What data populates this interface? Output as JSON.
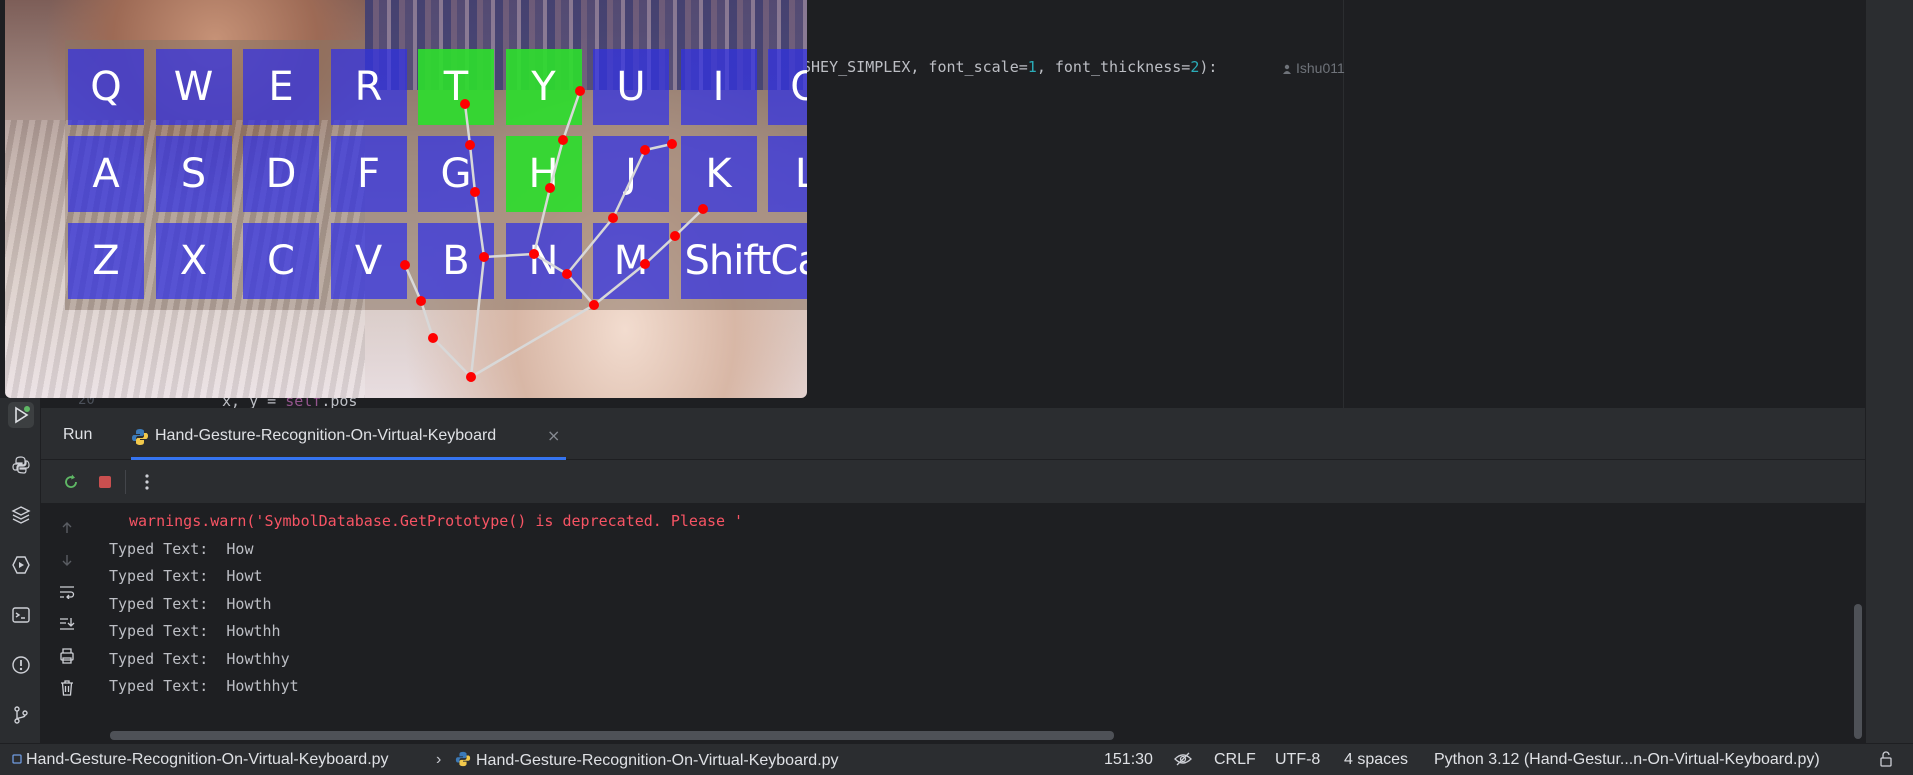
{
  "editor": {
    "code_fragment": {
      "prefix": "SHEY_SIMPLEX, font_scale=",
      "scale_value": "1",
      "middle": ", font_thickness=",
      "thickness_value": "2",
      "suffix": "):"
    },
    "author": "Ishu011",
    "partial_line_number": "20",
    "partial_line_code": "x, y = ",
    "partial_line_self": "self",
    "partial_line_tail": ".pos"
  },
  "keyboard": {
    "rows": [
      [
        "Q",
        "W",
        "E",
        "R",
        "T",
        "Y",
        "U",
        "I",
        "O"
      ],
      [
        "A",
        "S",
        "D",
        "F",
        "G",
        "H",
        "J",
        "K",
        "L"
      ],
      [
        "Z",
        "X",
        "C",
        "V",
        "B",
        "N",
        "M",
        "ShiftCa"
      ]
    ],
    "pressed": [
      "T",
      "Y",
      "H"
    ]
  },
  "run_panel": {
    "title": "Run",
    "tab_label": "Hand-Gesture-Recognition-On-Virtual-Keyboard",
    "close_glyph": "×",
    "console": {
      "warning_line": "warnings.warn('SymbolDatabase.GetPrototype() is deprecated. Please '",
      "lines": [
        "Typed Text:  How",
        "Typed Text:  Howt",
        "Typed Text:  Howth",
        "Typed Text:  Howthh",
        "Typed Text:  Howthhy",
        "Typed Text:  Howthhyt"
      ]
    }
  },
  "status_bar": {
    "project_file": "Hand-Gesture-Recognition-On-Virtual-Keyboard.py",
    "breadcrumb_file": "Hand-Gesture-Recognition-On-Virtual-Keyboard.py",
    "position": "151:30",
    "line_ending": "CRLF",
    "encoding": "UTF-8",
    "indent": "4 spaces",
    "interpreter": "Python 3.12 (Hand-Gestur...n-On-Virtual-Keyboard.py)"
  },
  "colors": {
    "key_blue": "#3030e6",
    "key_pressed": "#2edc2e",
    "landmark": "#ff0000",
    "warning_text": "#f75464",
    "accent": "#3574f0"
  }
}
